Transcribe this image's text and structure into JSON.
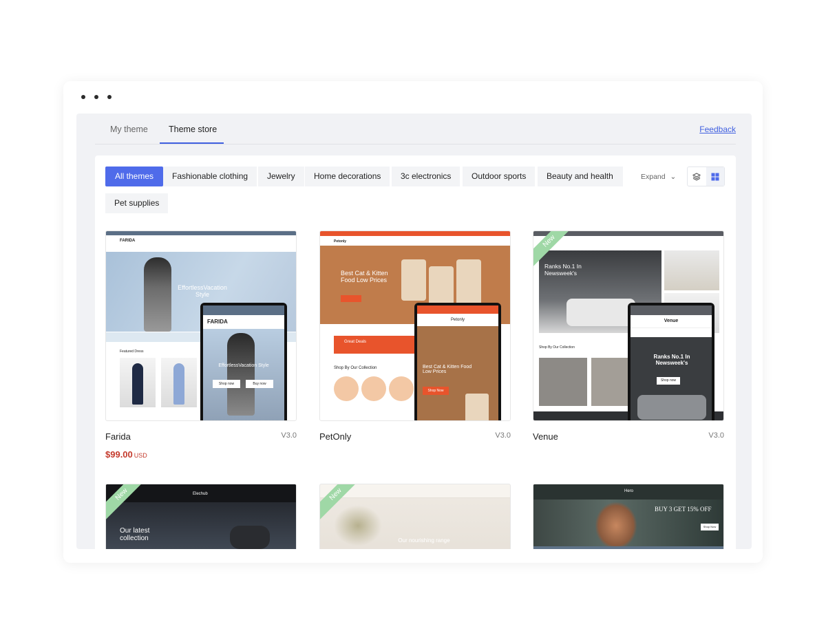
{
  "tabs": {
    "my_theme": "My theme",
    "theme_store": "Theme store"
  },
  "feedback": "Feedback",
  "categories": [
    "All themes",
    "Fashionable clothing",
    "Jewelry",
    "Home decorations",
    "3c electronics",
    "Outdoor sports",
    "Beauty and health",
    "Pet supplies"
  ],
  "expand_label": "Expand",
  "icons": {
    "expand": "chevron-down-icon",
    "layers": "layers-icon",
    "grid": "grid-icon"
  },
  "colors": {
    "accent": "#4f6bea",
    "price": "#c43a2c",
    "new_badge": "#9fd8a6"
  },
  "themes": [
    {
      "name": "Farida",
      "version": "V3.0",
      "price": "$99.00",
      "currency": "USD",
      "preview": {
        "brand": "FARIDA",
        "headline": "EffortlessVacation Style",
        "section": "Featured Dress",
        "button1": "Shop now",
        "button2": "Buy now"
      }
    },
    {
      "name": "PetOnly",
      "version": "V3.0",
      "preview": {
        "brand": "Petonly",
        "headline": "Best Cat & Kitten Food Low Prices",
        "deals": "Great Deals",
        "section": "Shop By Our Collection",
        "button": "Shop Now"
      }
    },
    {
      "name": "Venue",
      "version": "V3.0",
      "badge": "New",
      "preview": {
        "brand": "Venue",
        "headline": "Ranks No.1 In Newsweek's",
        "section": "Shop By Our Collection",
        "button": "Shop now"
      }
    },
    {
      "badge": "New",
      "preview": {
        "brand": "Elechub",
        "headline": "Our latest collection"
      }
    },
    {
      "badge": "New",
      "preview": {
        "headline": "Our nourishing range"
      }
    },
    {
      "preview": {
        "brand": "Hero",
        "headline": "BUY 3 GET 15% OFF",
        "button": "Shop Now"
      }
    }
  ]
}
